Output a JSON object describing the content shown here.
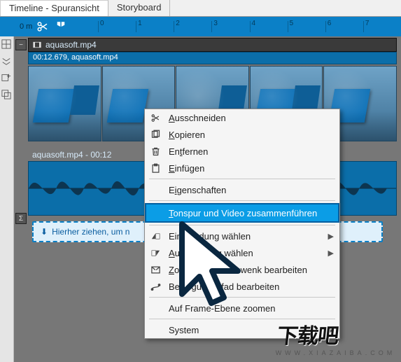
{
  "tabs": {
    "timeline": "Timeline - Spuransicht",
    "storyboard": "Storyboard"
  },
  "ruler": {
    "pos_label": "0 m",
    "ticks": [
      "0",
      "1",
      "2",
      "3",
      "4",
      "5",
      "6",
      "7"
    ]
  },
  "clip": {
    "filename": "aquasoft.mp4",
    "time_label": "00:12.679,  aquasoft.mp4",
    "audio_label": "aquasoft.mp4 - 00:12"
  },
  "drop_hint": "Hierher ziehen, um n",
  "context_menu": {
    "cut": "Ausschneiden",
    "copy": "Kopieren",
    "remove": "Entfernen",
    "paste": "Einfügen",
    "properties": "Eigenschaften",
    "merge": "Tonspur und Video zusammenführen",
    "fadein": "Einblendung wählen",
    "fadeout": "Ausblendung wählen",
    "zoompan": "Zoom/Kameraschwenk bearbeiten",
    "motionpath": "Bewegungspfad bearbeiten",
    "framelevel": "Auf Frame-Ebene zoomen",
    "system": "System"
  },
  "watermark": {
    "big": "下载吧",
    "small": "WWW.XIAZAIBA.COM"
  },
  "colors": {
    "accent": "#0b80c7",
    "highlight": "#0b9de6"
  }
}
